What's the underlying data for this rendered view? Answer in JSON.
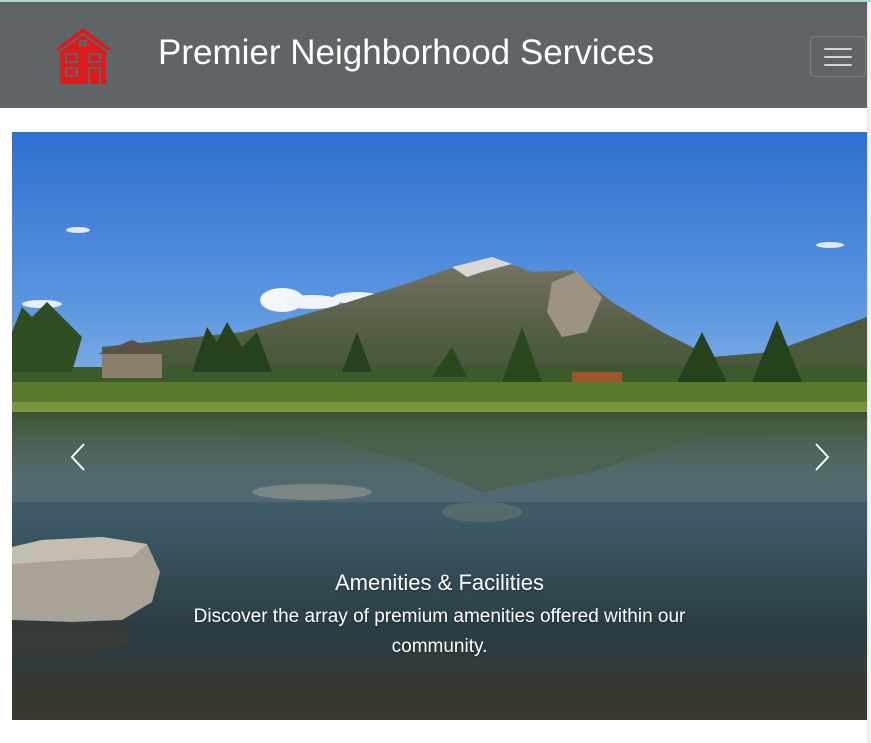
{
  "navbar": {
    "logo_icon": "red-house-icon",
    "title": "Premier Neighborhood Services",
    "toggler_icon": "hamburger-menu-icon",
    "background_color": "#5f6469",
    "logo_color": "#e01a1a"
  },
  "carousel": {
    "slide_image": "mountain-lake-reflection-photo",
    "caption_title": "Amenities & Facilities",
    "caption_text": "Discover the array of premium amenities offered within our community.",
    "prev_icon": "chevron-left-icon",
    "next_icon": "chevron-right-icon"
  }
}
